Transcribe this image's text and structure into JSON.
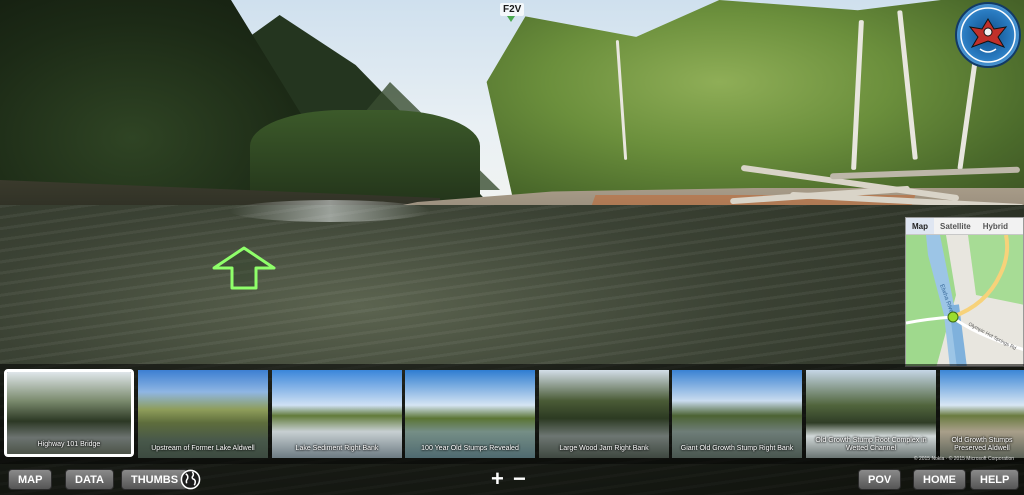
{
  "scene": {
    "marker_label": "F2V"
  },
  "logo": {
    "name": "tribe-logo",
    "text": "LOWER ELWHA KLALLAM TRIBE"
  },
  "minimap": {
    "tabs": [
      "Map",
      "Satellite",
      "Hybrid"
    ],
    "active_tab": "Map",
    "labels": [
      "Elwha River",
      "Olympic Hot Springs Rd"
    ],
    "credit": "© 2015 Nokia · © 2015 Microsoft Corporation"
  },
  "thumbnails": [
    {
      "caption": "Highway 101 Bridge",
      "selected": true
    },
    {
      "caption": "Upstream of Former Lake Aldwell",
      "selected": false
    },
    {
      "caption": "Lake Sediment Right Bank",
      "selected": false
    },
    {
      "caption": "100 Year Old Stumps Revealed",
      "selected": false
    },
    {
      "caption": "Large Wood Jam Right Bank",
      "selected": false
    },
    {
      "caption": "Giant Old Growth Stump Right Bank",
      "selected": false
    },
    {
      "caption": "Old Growth Stump Root Complex in Wetted Channel",
      "selected": false
    },
    {
      "caption": "Old Growth Stumps Preserved Aldwell",
      "selected": false
    }
  ],
  "toolbar": {
    "map_label": "MAP",
    "data_label": "DATA",
    "thumbs_label": "THUMBS",
    "zoom_in_label": "+",
    "zoom_out_label": "−",
    "pov_label": "POV",
    "home_label": "HOME",
    "help_label": "HELP"
  },
  "icons": {
    "globe": "globe-icon",
    "nav_arrow": "forward-arrow-icon"
  }
}
